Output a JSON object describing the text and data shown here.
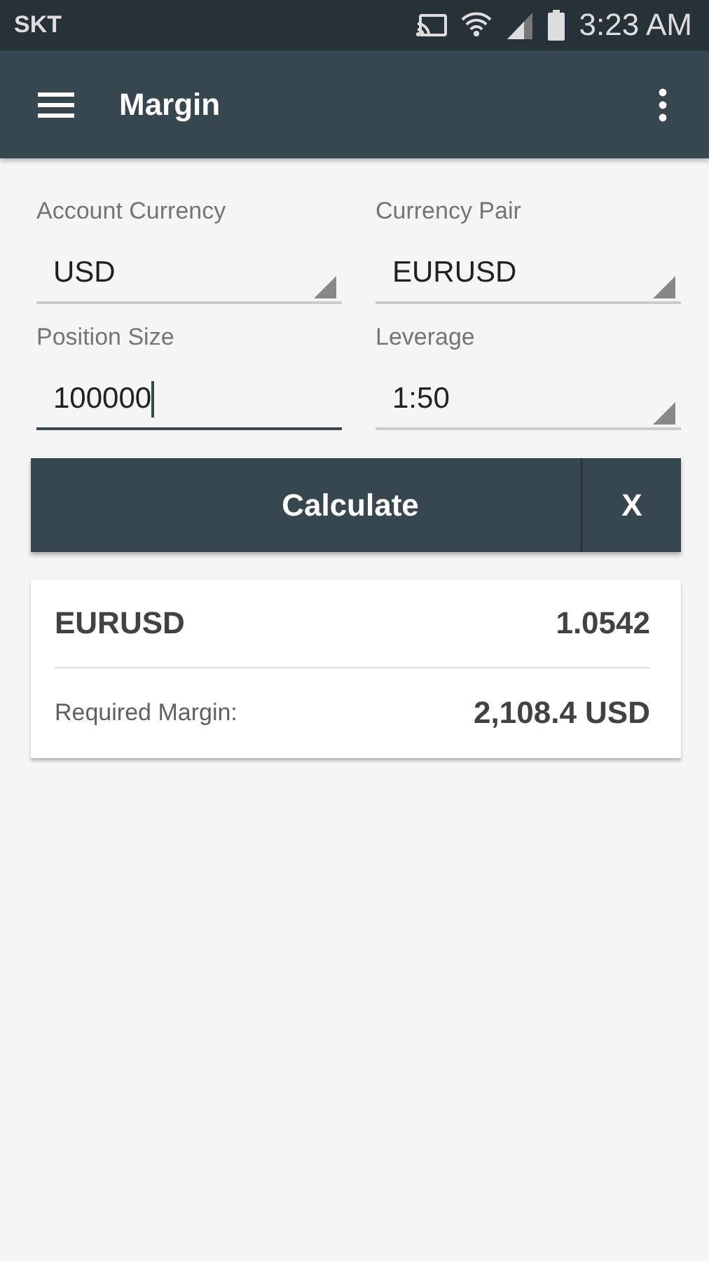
{
  "status_bar": {
    "carrier": "SKT",
    "time": "3:23 AM"
  },
  "app_bar": {
    "title": "Margin"
  },
  "fields": [
    {
      "label": "Account Currency",
      "value": "USD",
      "kind": "dropdown",
      "focused": false
    },
    {
      "label": "Currency Pair",
      "value": "EURUSD",
      "kind": "dropdown",
      "focused": false
    },
    {
      "label": "Position Size",
      "value": "100000",
      "kind": "input",
      "focused": true
    },
    {
      "label": "Leverage",
      "value": "1:50",
      "kind": "dropdown",
      "focused": false
    }
  ],
  "buttons": {
    "calculate": "Calculate",
    "clear": "X"
  },
  "result": {
    "pair": "EURUSD",
    "rate": "1.0542",
    "margin_label": "Required Margin:",
    "margin_value": "2,108.4 USD"
  }
}
